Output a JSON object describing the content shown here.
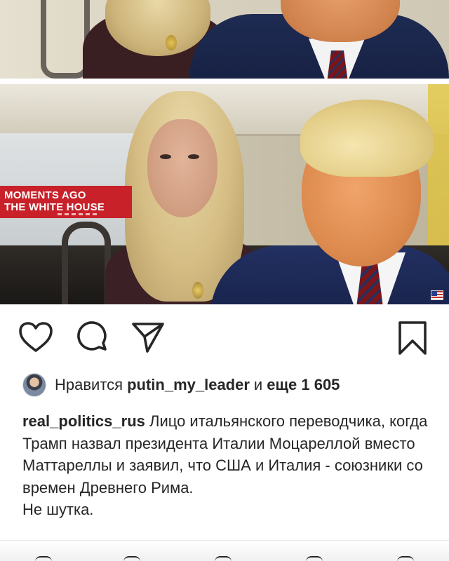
{
  "post": {
    "image_overlay": {
      "line1": "MOMENTS AGO",
      "line2": "THE WHITE HOUSE"
    },
    "actions": {
      "like_icon": "heart-outline-icon",
      "comment_icon": "speech-bubble-icon",
      "share_icon": "paper-plane-icon",
      "save_icon": "bookmark-outline-icon"
    },
    "likes": {
      "prefix": "Нравится",
      "user": "putin_my_leader",
      "conjunction": "и",
      "more": "еще 1 605"
    },
    "caption": {
      "username": "real_politics_rus",
      "text": "Лицо итальянского переводчика, когда Трамп назвал президента Италии Моцареллой вместо Маттареллы и заявил, что США и Италия - союзники со времен Древнего Рима.",
      "note": "Не шутка."
    }
  }
}
